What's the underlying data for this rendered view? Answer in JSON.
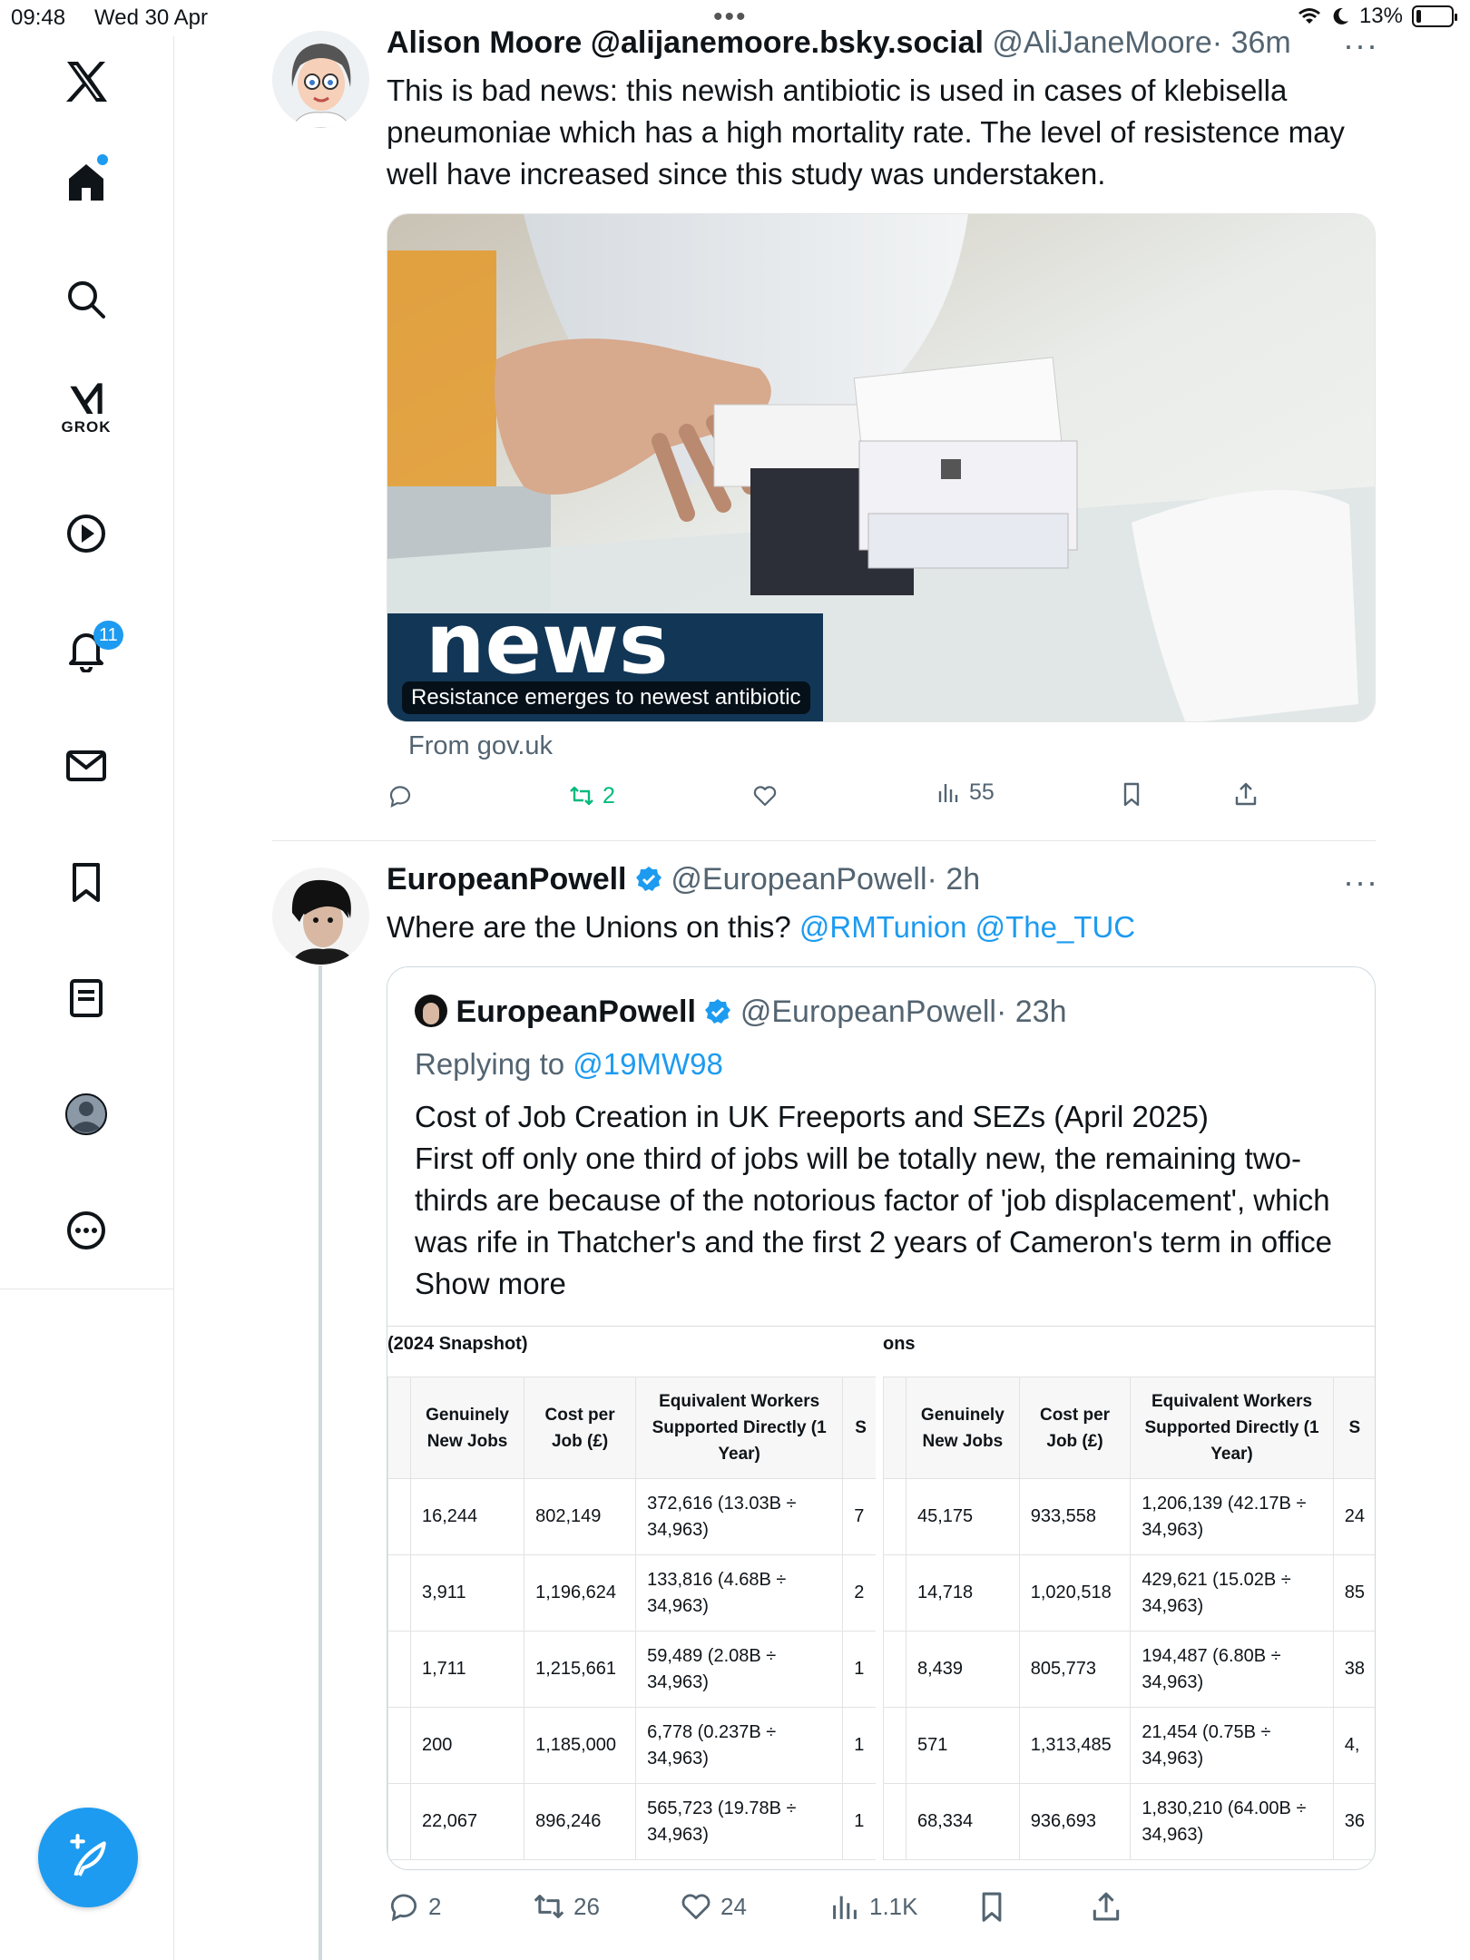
{
  "status_bar": {
    "time": "09:48",
    "date": "Wed 30 Apr",
    "battery": "13%"
  },
  "sidebar": {
    "grok_label": "GROK",
    "notifications_badge": "11",
    "items": [
      {
        "icon": "x-logo-icon"
      },
      {
        "icon": "home-icon"
      },
      {
        "icon": "search-icon"
      },
      {
        "icon": "grok-icon"
      },
      {
        "icon": "video-play-icon"
      },
      {
        "icon": "bell-icon"
      },
      {
        "icon": "mail-icon"
      },
      {
        "icon": "bookmark-icon"
      },
      {
        "icon": "lists-icon"
      },
      {
        "icon": "profile-icon"
      },
      {
        "icon": "more-circle-icon"
      },
      {
        "icon": "compose-post-icon"
      }
    ]
  },
  "tweets": [
    {
      "name": "Alison Moore @alijanemoore.bsky.social",
      "handle": "@AliJaneMoore",
      "time": "· 36m",
      "text": "This is bad news: this newish antibiotic is used in cases of klebisella pneumoniae which has a high mortality rate. The level of resistence may well have increased since this study was understaken.",
      "card": {
        "banner_text": "news",
        "caption": "Resistance emerges to newest antibiotic",
        "source": "From gov.uk"
      },
      "actions": {
        "replies": "",
        "reposts": "2",
        "likes": "",
        "views": "55"
      }
    },
    {
      "name": "EuropeanPowell",
      "handle": "@EuropeanPowell",
      "time": "· 2h",
      "text_prefix": "Where are the Unions on this? ",
      "mention1": "@RMTunion",
      "mention2": "@The_TUC",
      "quote": {
        "name": "EuropeanPowell",
        "handle": "@EuropeanPowell",
        "time": "· 23h",
        "replying_prefix": "Replying to ",
        "replying_to": "@19MW98",
        "text": "Cost of Job Creation in UK Freeports and SEZs (April 2025)\nFirst off only one third of jobs will be totally new, the remaining two-thirds are because of the notorious factor of 'job displacement', which was rife in Thatcher's and the first 2 years of Cameron's term in office",
        "show_more": "Show more",
        "table": {
          "left_title": "(2024 Snapshot)",
          "right_title": "ons",
          "headers": [
            "Genuinely New Jobs",
            "Cost per Job (£)",
            "Equivalent Workers Supported Directly (1 Year)",
            "S"
          ],
          "left_rows": [
            [
              "16,244",
              "802,149",
              "372,616 (13.03B ÷ 34,963)",
              "7"
            ],
            [
              "3,911",
              "1,196,624",
              "133,816 (4.68B ÷ 34,963)",
              "2"
            ],
            [
              "1,711",
              "1,215,661",
              "59,489 (2.08B ÷ 34,963)",
              "1"
            ],
            [
              "200",
              "1,185,000",
              "6,778 (0.237B ÷ 34,963)",
              "1"
            ],
            [
              "22,067",
              "896,246",
              "565,723 (19.78B ÷ 34,963)",
              "1"
            ]
          ],
          "right_rows": [
            [
              "45,175",
              "933,558",
              "1,206,139 (42.17B ÷ 34,963)",
              "24"
            ],
            [
              "14,718",
              "1,020,518",
              "429,621 (15.02B ÷ 34,963)",
              "85"
            ],
            [
              "8,439",
              "805,773",
              "194,487 (6.80B ÷ 34,963)",
              "38"
            ],
            [
              "571",
              "1,313,485",
              "21,454 (0.75B ÷ 34,963)",
              "4,"
            ],
            [
              "68,334",
              "936,693",
              "1,830,210 (64.00B ÷ 34,963)",
              "36"
            ]
          ]
        }
      },
      "actions": {
        "replies": "2",
        "reposts": "26",
        "likes": "24",
        "views": "1.1K"
      }
    }
  ],
  "colors": {
    "accent": "#1d9bf0",
    "repost_active": "#00ba7c",
    "secondary_text": "#536471"
  }
}
